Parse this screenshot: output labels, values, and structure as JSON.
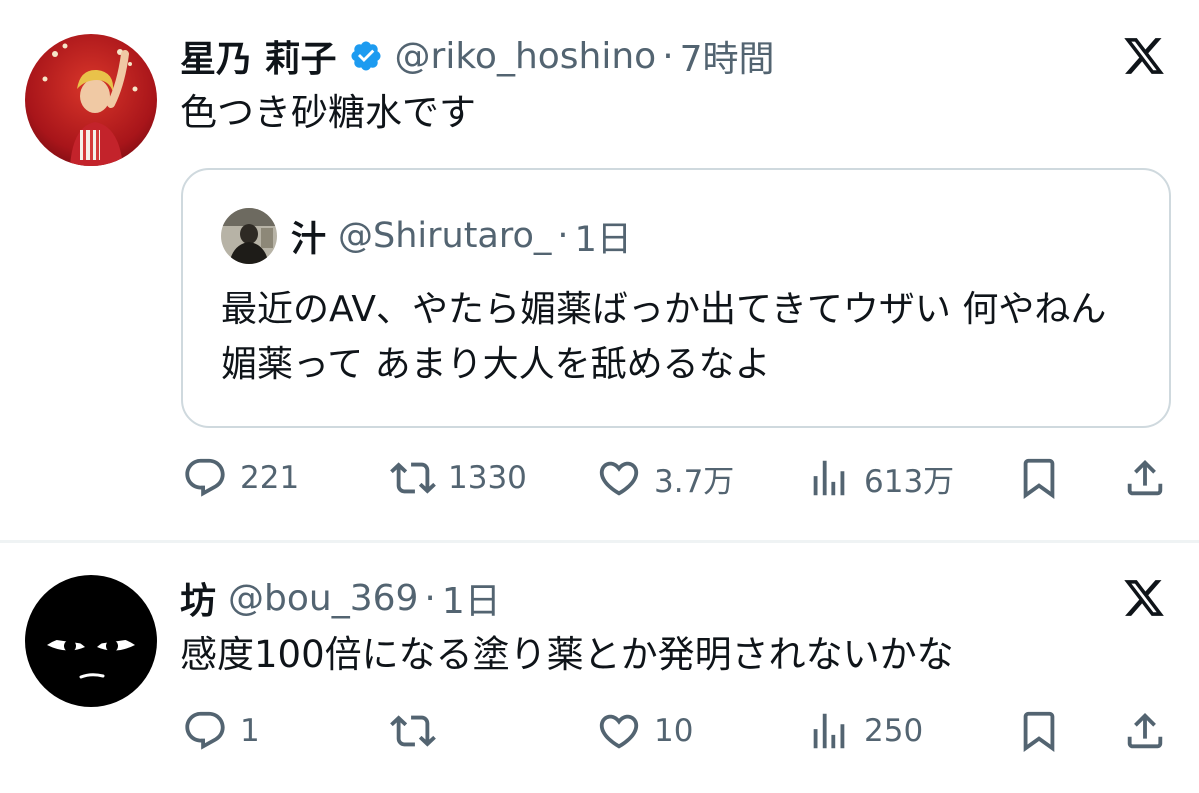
{
  "tweets": [
    {
      "name": "星乃 莉子",
      "handle": "@riko_hoshino",
      "separator": "·",
      "time": "7時間",
      "text": "色つき砂糖水です",
      "verified": true,
      "quote": {
        "name": "汁",
        "handle": "@Shirutaro_",
        "separator": "·",
        "time": "1日",
        "text": "最近のAV、やたら媚薬ばっか出てきてウザい 何やねん媚薬って あまり大人を舐めるなよ"
      },
      "actions": {
        "replies": "221",
        "retweets": "1330",
        "likes": "3.7万",
        "views": "613万"
      }
    },
    {
      "name": "坊",
      "handle": "@bou_369",
      "separator": "·",
      "time": "1日",
      "text": "感度100倍になる塗り薬とか発明されないかな",
      "verified": false,
      "actions": {
        "replies": "1",
        "retweets": "",
        "likes": "10",
        "views": "250"
      }
    }
  ],
  "icons": {
    "verified": "verified-badge-icon",
    "platform": "x-logo-icon",
    "reply": "reply-icon",
    "retweet": "retweet-icon",
    "like": "heart-icon",
    "views": "views-chart-icon",
    "bookmark": "bookmark-icon",
    "share": "share-icon"
  },
  "colors": {
    "text": "#0f1419",
    "secondary": "#536471",
    "verified": "#1d9bf0",
    "border": "#cfd9de",
    "divider": "#eff3f4"
  }
}
